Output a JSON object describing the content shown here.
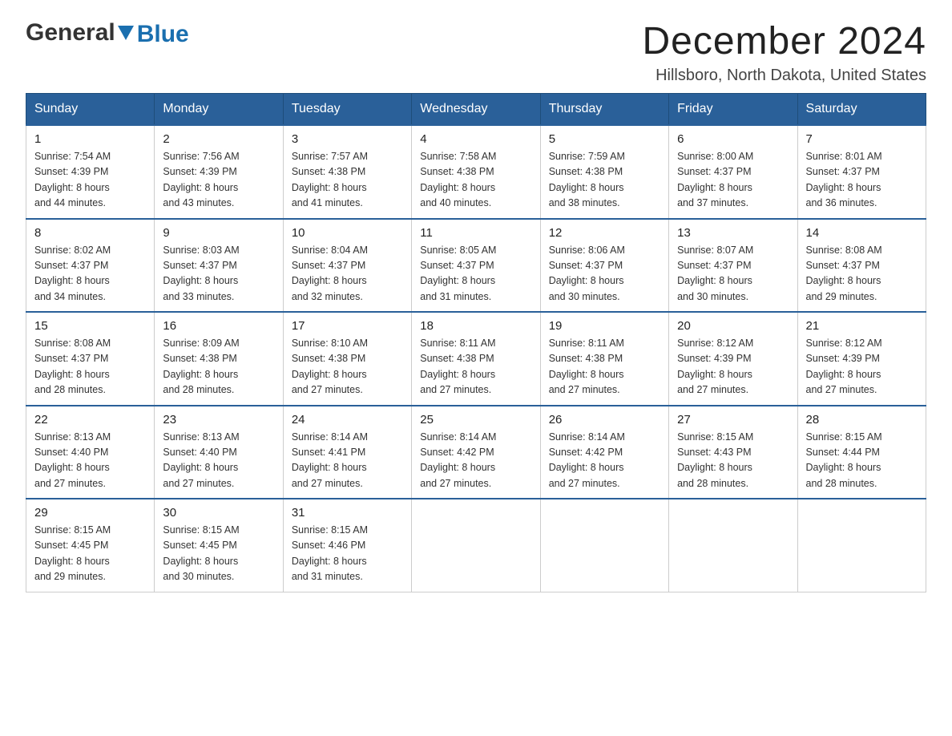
{
  "logo": {
    "general": "General",
    "blue": "Blue"
  },
  "title": "December 2024",
  "location": "Hillsboro, North Dakota, United States",
  "weekdays": [
    "Sunday",
    "Monday",
    "Tuesday",
    "Wednesday",
    "Thursday",
    "Friday",
    "Saturday"
  ],
  "weeks": [
    [
      {
        "day": "1",
        "sunrise": "7:54 AM",
        "sunset": "4:39 PM",
        "daylight": "8 hours and 44 minutes."
      },
      {
        "day": "2",
        "sunrise": "7:56 AM",
        "sunset": "4:39 PM",
        "daylight": "8 hours and 43 minutes."
      },
      {
        "day": "3",
        "sunrise": "7:57 AM",
        "sunset": "4:38 PM",
        "daylight": "8 hours and 41 minutes."
      },
      {
        "day": "4",
        "sunrise": "7:58 AM",
        "sunset": "4:38 PM",
        "daylight": "8 hours and 40 minutes."
      },
      {
        "day": "5",
        "sunrise": "7:59 AM",
        "sunset": "4:38 PM",
        "daylight": "8 hours and 38 minutes."
      },
      {
        "day": "6",
        "sunrise": "8:00 AM",
        "sunset": "4:37 PM",
        "daylight": "8 hours and 37 minutes."
      },
      {
        "day": "7",
        "sunrise": "8:01 AM",
        "sunset": "4:37 PM",
        "daylight": "8 hours and 36 minutes."
      }
    ],
    [
      {
        "day": "8",
        "sunrise": "8:02 AM",
        "sunset": "4:37 PM",
        "daylight": "8 hours and 34 minutes."
      },
      {
        "day": "9",
        "sunrise": "8:03 AM",
        "sunset": "4:37 PM",
        "daylight": "8 hours and 33 minutes."
      },
      {
        "day": "10",
        "sunrise": "8:04 AM",
        "sunset": "4:37 PM",
        "daylight": "8 hours and 32 minutes."
      },
      {
        "day": "11",
        "sunrise": "8:05 AM",
        "sunset": "4:37 PM",
        "daylight": "8 hours and 31 minutes."
      },
      {
        "day": "12",
        "sunrise": "8:06 AM",
        "sunset": "4:37 PM",
        "daylight": "8 hours and 30 minutes."
      },
      {
        "day": "13",
        "sunrise": "8:07 AM",
        "sunset": "4:37 PM",
        "daylight": "8 hours and 30 minutes."
      },
      {
        "day": "14",
        "sunrise": "8:08 AM",
        "sunset": "4:37 PM",
        "daylight": "8 hours and 29 minutes."
      }
    ],
    [
      {
        "day": "15",
        "sunrise": "8:08 AM",
        "sunset": "4:37 PM",
        "daylight": "8 hours and 28 minutes."
      },
      {
        "day": "16",
        "sunrise": "8:09 AM",
        "sunset": "4:38 PM",
        "daylight": "8 hours and 28 minutes."
      },
      {
        "day": "17",
        "sunrise": "8:10 AM",
        "sunset": "4:38 PM",
        "daylight": "8 hours and 27 minutes."
      },
      {
        "day": "18",
        "sunrise": "8:11 AM",
        "sunset": "4:38 PM",
        "daylight": "8 hours and 27 minutes."
      },
      {
        "day": "19",
        "sunrise": "8:11 AM",
        "sunset": "4:38 PM",
        "daylight": "8 hours and 27 minutes."
      },
      {
        "day": "20",
        "sunrise": "8:12 AM",
        "sunset": "4:39 PM",
        "daylight": "8 hours and 27 minutes."
      },
      {
        "day": "21",
        "sunrise": "8:12 AM",
        "sunset": "4:39 PM",
        "daylight": "8 hours and 27 minutes."
      }
    ],
    [
      {
        "day": "22",
        "sunrise": "8:13 AM",
        "sunset": "4:40 PM",
        "daylight": "8 hours and 27 minutes."
      },
      {
        "day": "23",
        "sunrise": "8:13 AM",
        "sunset": "4:40 PM",
        "daylight": "8 hours and 27 minutes."
      },
      {
        "day": "24",
        "sunrise": "8:14 AM",
        "sunset": "4:41 PM",
        "daylight": "8 hours and 27 minutes."
      },
      {
        "day": "25",
        "sunrise": "8:14 AM",
        "sunset": "4:42 PM",
        "daylight": "8 hours and 27 minutes."
      },
      {
        "day": "26",
        "sunrise": "8:14 AM",
        "sunset": "4:42 PM",
        "daylight": "8 hours and 27 minutes."
      },
      {
        "day": "27",
        "sunrise": "8:15 AM",
        "sunset": "4:43 PM",
        "daylight": "8 hours and 28 minutes."
      },
      {
        "day": "28",
        "sunrise": "8:15 AM",
        "sunset": "4:44 PM",
        "daylight": "8 hours and 28 minutes."
      }
    ],
    [
      {
        "day": "29",
        "sunrise": "8:15 AM",
        "sunset": "4:45 PM",
        "daylight": "8 hours and 29 minutes."
      },
      {
        "day": "30",
        "sunrise": "8:15 AM",
        "sunset": "4:45 PM",
        "daylight": "8 hours and 30 minutes."
      },
      {
        "day": "31",
        "sunrise": "8:15 AM",
        "sunset": "4:46 PM",
        "daylight": "8 hours and 31 minutes."
      },
      null,
      null,
      null,
      null
    ]
  ],
  "labels": {
    "sunrise": "Sunrise:",
    "sunset": "Sunset:",
    "daylight": "Daylight:"
  }
}
